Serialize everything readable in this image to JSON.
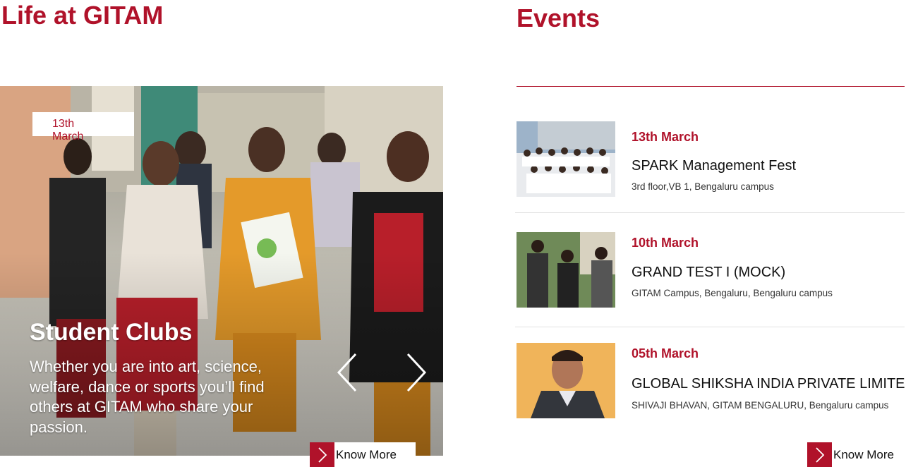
{
  "left_section": {
    "title": "Life at GITAM"
  },
  "right_section": {
    "title": "Events"
  },
  "hero_card": {
    "date": "13th March",
    "title": "Student Clubs",
    "description": "Whether you are into art, science, welfare, dance or sports you’ll find others at GITAM who share your passion.",
    "prev_icon": "chevron-left-icon",
    "next_icon": "chevron-right-icon",
    "know_more": "Know More"
  },
  "events": [
    {
      "date": "13th March",
      "name": "SPARK Management Fest",
      "location": "3rd floor,VB 1, Bengaluru campus"
    },
    {
      "date": "10th March",
      "name": "GRAND TEST I (MOCK)",
      "location": "GITAM Campus, Bengaluru, Bengaluru campus"
    },
    {
      "date": "05th March",
      "name": "GLOBAL SHIKSHA INDIA PRIVATE LIMITED",
      "location": "SHIVAJI BHAVAN, GITAM BENGALURU, Bengaluru campus"
    }
  ],
  "events_know_more": "Know More",
  "colors": {
    "accent": "#b0122a",
    "divider": "#e1e1e1"
  }
}
